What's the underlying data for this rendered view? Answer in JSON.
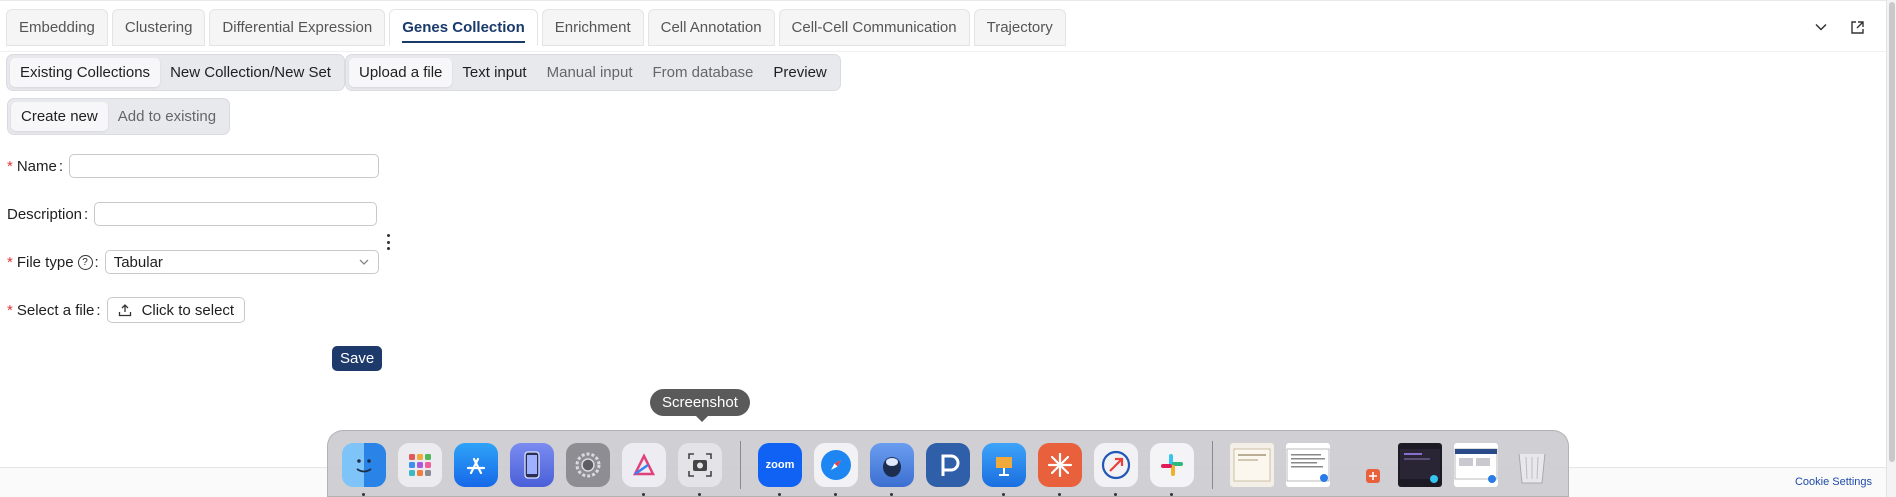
{
  "tabs": [
    {
      "label": "Embedding"
    },
    {
      "label": "Clustering"
    },
    {
      "label": "Differential Expression"
    },
    {
      "label": "Genes Collection",
      "active": true
    },
    {
      "label": "Enrichment"
    },
    {
      "label": "Cell Annotation"
    },
    {
      "label": "Cell-Cell Communication"
    },
    {
      "label": "Trajectory"
    }
  ],
  "collection_mode": {
    "options": [
      "Existing Collections",
      "New Collection/New Set"
    ],
    "selected": "Existing Collections"
  },
  "input_method": {
    "options": [
      "Upload a file",
      "Text input",
      "Manual input",
      "From database",
      "Preview"
    ],
    "selected": "Upload a file"
  },
  "create_mode": {
    "options": [
      "Create new",
      "Add to existing"
    ],
    "selected": "Create new"
  },
  "form": {
    "required_mark": "*",
    "name_label": "Name",
    "name_value": "",
    "description_label": "Description",
    "description_value": "",
    "file_type_label": "File type",
    "file_type_help": "?",
    "file_type_value": "Tabular",
    "select_file_label": "Select a file",
    "select_file_button": "Click to select",
    "colon": ":",
    "save_label": "Save"
  },
  "tooltip": "Screenshot",
  "footer": {
    "cookie_settings": "Cookie Settings"
  },
  "dock": {
    "apps": [
      {
        "name": "finder",
        "color": "#2a8cf0"
      },
      {
        "name": "launchpad",
        "color": "#e8e8ec"
      },
      {
        "name": "app-store",
        "color": "#1d8cf5"
      },
      {
        "name": "simulator",
        "color": "#5b6ee0"
      },
      {
        "name": "system-settings",
        "color": "#8a8a90"
      },
      {
        "name": "affinity",
        "color": "#e9e9ef"
      },
      {
        "name": "screenshot",
        "color": "#e4e4e8"
      },
      {
        "name": "zoom",
        "color": "#1062f5",
        "text": "zoom"
      },
      {
        "name": "safari",
        "color": "#1e7ff0"
      },
      {
        "name": "ollama",
        "color": "#4a7fe0"
      },
      {
        "name": "pockity",
        "color": "#2f5fa8"
      },
      {
        "name": "keynote",
        "color": "#2d8ff3"
      },
      {
        "name": "claude",
        "color": "#e8603c"
      },
      {
        "name": "migrate",
        "color": "#f2f2f4"
      },
      {
        "name": "slack",
        "color": "#f4f4f6"
      }
    ],
    "docs": [
      {
        "name": "doc-thumbnail-1"
      },
      {
        "name": "doc-thumbnail-2"
      },
      {
        "name": "doc-thumbnail-3"
      },
      {
        "name": "doc-thumbnail-4"
      },
      {
        "name": "doc-thumbnail-5"
      },
      {
        "name": "trash"
      }
    ]
  }
}
